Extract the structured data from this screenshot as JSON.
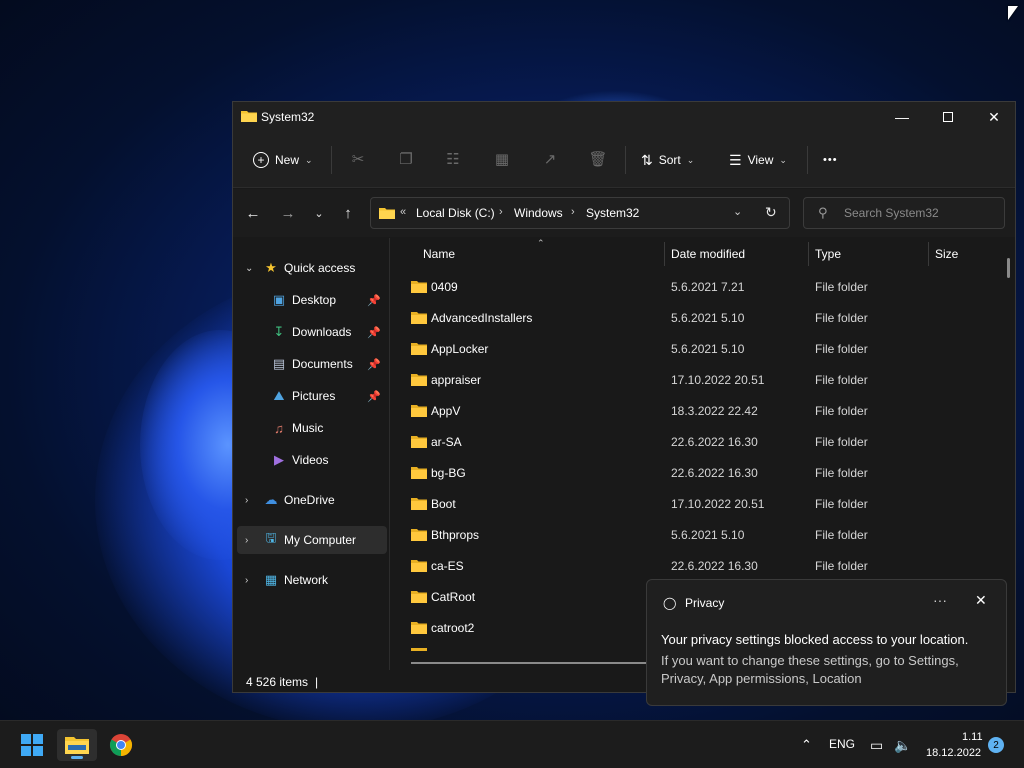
{
  "colors": {
    "accent": "#5fb2f2",
    "folder": "#f4c430",
    "window_bg": "#191919",
    "taskbar_bg": "#1c1c1c"
  },
  "window": {
    "title": "System32"
  },
  "toolbar": {
    "new_label": "New",
    "sort_label": "Sort",
    "view_label": "View",
    "more_label": "•••"
  },
  "address": {
    "overflow": "«",
    "crumbs": [
      "Local Disk (C:)",
      "Windows",
      "System32"
    ]
  },
  "search": {
    "placeholder": "Search System32"
  },
  "sidebar": {
    "quick_access": "Quick access",
    "items": [
      {
        "label": "Desktop",
        "icon": "desktop-icon",
        "pinned": true
      },
      {
        "label": "Downloads",
        "icon": "download-icon",
        "pinned": true
      },
      {
        "label": "Documents",
        "icon": "document-icon",
        "pinned": true
      },
      {
        "label": "Pictures",
        "icon": "picture-icon",
        "pinned": true
      },
      {
        "label": "Music",
        "icon": "music-icon",
        "pinned": false
      },
      {
        "label": "Videos",
        "icon": "video-icon",
        "pinned": false
      }
    ],
    "onedrive": "OneDrive",
    "my_computer": "My Computer",
    "network": "Network"
  },
  "columns": {
    "name": "Name",
    "date": "Date modified",
    "type": "Type",
    "size": "Size"
  },
  "files": [
    {
      "name": "0409",
      "date": "5.6.2021 7.21",
      "type": "File folder"
    },
    {
      "name": "AdvancedInstallers",
      "date": "5.6.2021 5.10",
      "type": "File folder"
    },
    {
      "name": "AppLocker",
      "date": "5.6.2021 5.10",
      "type": "File folder"
    },
    {
      "name": "appraiser",
      "date": "17.10.2022 20.51",
      "type": "File folder"
    },
    {
      "name": "AppV",
      "date": "18.3.2022 22.42",
      "type": "File folder"
    },
    {
      "name": "ar-SA",
      "date": "22.6.2022 16.30",
      "type": "File folder"
    },
    {
      "name": "bg-BG",
      "date": "22.6.2022 16.30",
      "type": "File folder"
    },
    {
      "name": "Boot",
      "date": "17.10.2022 20.51",
      "type": "File folder"
    },
    {
      "name": "Bthprops",
      "date": "5.6.2021 5.10",
      "type": "File folder"
    },
    {
      "name": "ca-ES",
      "date": "22.6.2022 16.30",
      "type": "File folder"
    },
    {
      "name": "CatRoot",
      "date": "",
      "type": ""
    },
    {
      "name": "catroot2",
      "date": "",
      "type": ""
    }
  ],
  "status": {
    "items": "4 526 items",
    "cursor": "|"
  },
  "toast": {
    "title": "Privacy",
    "more": "···",
    "line1": "Your privacy settings blocked access to your location.",
    "line2": "If you want to change these settings, go to Settings, Privacy, App permissions, Location"
  },
  "taskbar": {
    "language": "ENG",
    "time": "1.11",
    "date": "18.12.2022",
    "notifications": "2"
  }
}
